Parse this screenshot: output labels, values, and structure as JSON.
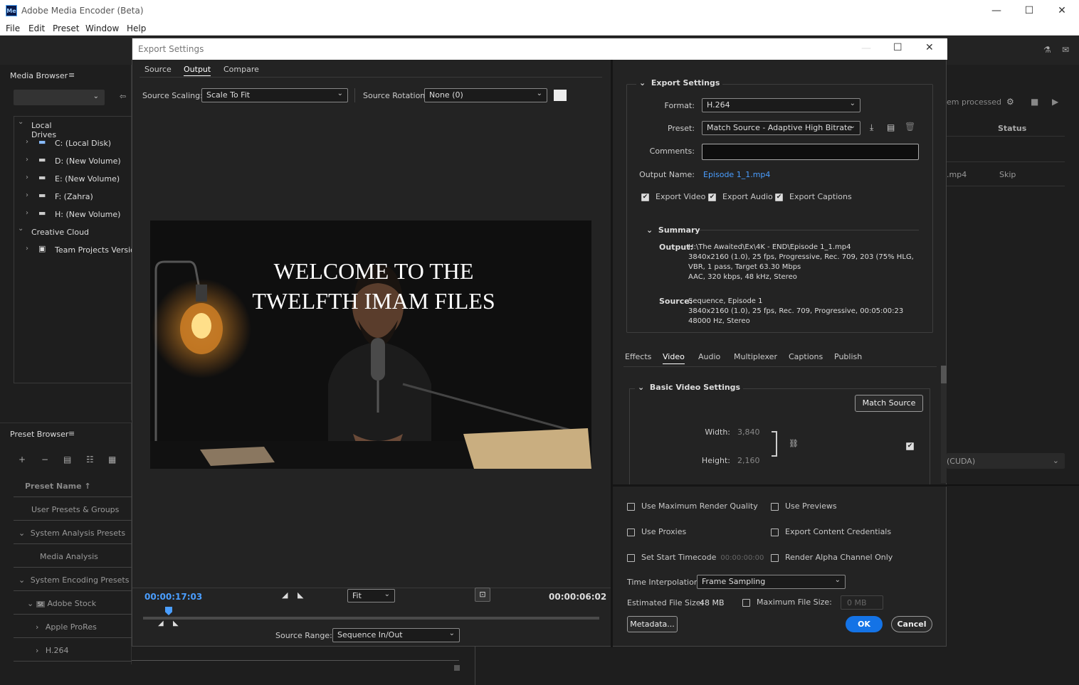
{
  "app": {
    "title": "Adobe Media Encoder (Beta)",
    "icon": "Me"
  },
  "menu": [
    "File",
    "Edit",
    "Preset",
    "Window",
    "Help"
  ],
  "media_browser": {
    "title": "Media Browser",
    "local_drives": "Local Drives",
    "drives": [
      "C: (Local Disk)",
      "D: (New Volume)",
      "E: (New Volume)",
      "F: (Zahra)",
      "H: (New Volume)"
    ],
    "creative_cloud": "Creative Cloud",
    "team_projects": "Team Projects Version"
  },
  "preset_browser": {
    "title": "Preset Browser",
    "column": "Preset Name",
    "items": [
      "User Presets & Groups",
      "System Analysis Presets",
      "Media Analysis",
      "System Encoding Presets",
      "Adobe Stock",
      "Apple ProRes",
      "H.264"
    ]
  },
  "queue": {
    "processed": "em processed",
    "status_header": "Status",
    "row_file": ".mp4",
    "row_status": "Skip",
    "renderer": "(CUDA)"
  },
  "dialog": {
    "title": "Export Settings",
    "tabs": [
      "Source",
      "Output",
      "Compare"
    ],
    "source_scaling_label": "Source Scaling:",
    "source_scaling": "Scale To Fit",
    "source_rotation_label": "Source Rotation:",
    "source_rotation": "None (0)",
    "video_text_line1": "WELCOME TO THE",
    "video_text_line2": "TWELFTH IMAM FILES",
    "timecode_current": "00:00:17:03",
    "timecode_total": "00:00:06:02",
    "fit": "Fit",
    "source_range_label": "Source Range:",
    "source_range": "Sequence In/Out",
    "export_settings": {
      "title": "Export Settings",
      "format_label": "Format:",
      "format": "H.264",
      "preset_label": "Preset:",
      "preset": "Match Source - Adaptive High Bitrate",
      "comments_label": "Comments:",
      "output_name_label": "Output Name:",
      "output_name": "Episode 1_1.mp4",
      "export_video": "Export Video",
      "export_audio": "Export Audio",
      "export_captions": "Export Captions"
    },
    "summary": {
      "title": "Summary",
      "output_label": "Output:",
      "output_lines": [
        "H:\\The Awaited\\Ex\\4K - END\\Episode 1_1.mp4",
        "3840x2160 (1.0), 25 fps, Progressive, Rec. 709, 203 (75% HLG, 5...",
        "VBR, 1 pass, Target 63.30 Mbps",
        "AAC, 320 kbps, 48 kHz, Stereo"
      ],
      "source_label": "Source:",
      "source_lines": [
        "Sequence, Episode 1",
        "3840x2160 (1.0), 25 fps, Rec. 709, Progressive, 00:05:00:23",
        "48000 Hz, Stereo"
      ]
    },
    "sub_tabs": [
      "Effects",
      "Video",
      "Audio",
      "Multiplexer",
      "Captions",
      "Publish"
    ],
    "basic_video": {
      "title": "Basic Video Settings",
      "match_source": "Match Source",
      "width_label": "Width:",
      "width": "3,840",
      "height_label": "Height:",
      "height": "2,160"
    },
    "options": {
      "max_render": "Use Maximum Render Quality",
      "use_previews": "Use Previews",
      "use_proxies": "Use Proxies",
      "export_credentials": "Export Content Credentials",
      "set_start_tc": "Set Start Timecode",
      "start_tc": "00:00:00:00",
      "render_alpha": "Render Alpha Channel Only",
      "time_interp_label": "Time Interpolation:",
      "time_interp": "Frame Sampling",
      "est_size_label": "Estimated File Size:",
      "est_size": "48 MB",
      "max_size_label": "Maximum File Size:",
      "max_size": "0 MB",
      "metadata": "Metadata...",
      "ok": "OK",
      "cancel": "Cancel"
    }
  }
}
